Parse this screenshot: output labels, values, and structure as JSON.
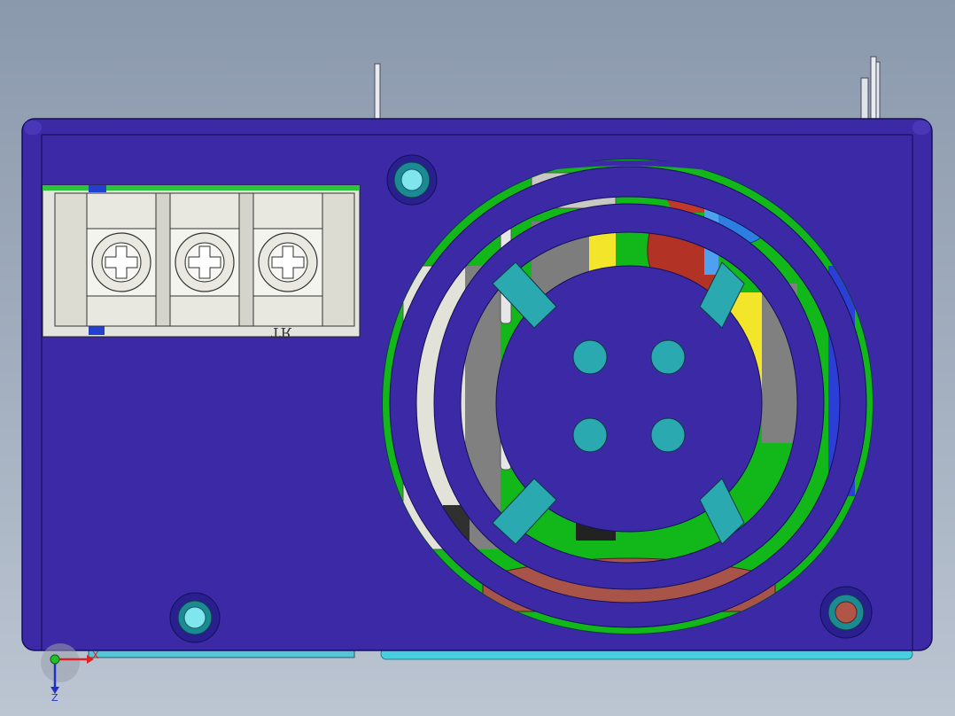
{
  "view": {
    "background_top": "#8b99ad",
    "background_bottom": "#bcc5d2"
  },
  "model": {
    "part": "power-supply-enclosure",
    "view_direction": "front",
    "colors": {
      "housing": "#3c29a5",
      "housing_edge": "#1a1466",
      "teal_ring": "#1e8a8e",
      "teal_light": "#2aa9b0",
      "pcb_green": "#12b81a",
      "capacitor_blue": "#2c7fe0",
      "yellow": "#f2e52a",
      "red": "#b23326",
      "brown": "#a95449",
      "terminal_beige": "#e6e6dc",
      "gray_part": "#7f7f7f"
    },
    "terminal_block": {
      "screw_count": 3,
      "marking": "TR"
    }
  },
  "triad": {
    "x_label": "X",
    "z_label": "Z",
    "x_color": "#e02020",
    "z_color": "#2230c8",
    "origin_color": "#22c02a"
  }
}
